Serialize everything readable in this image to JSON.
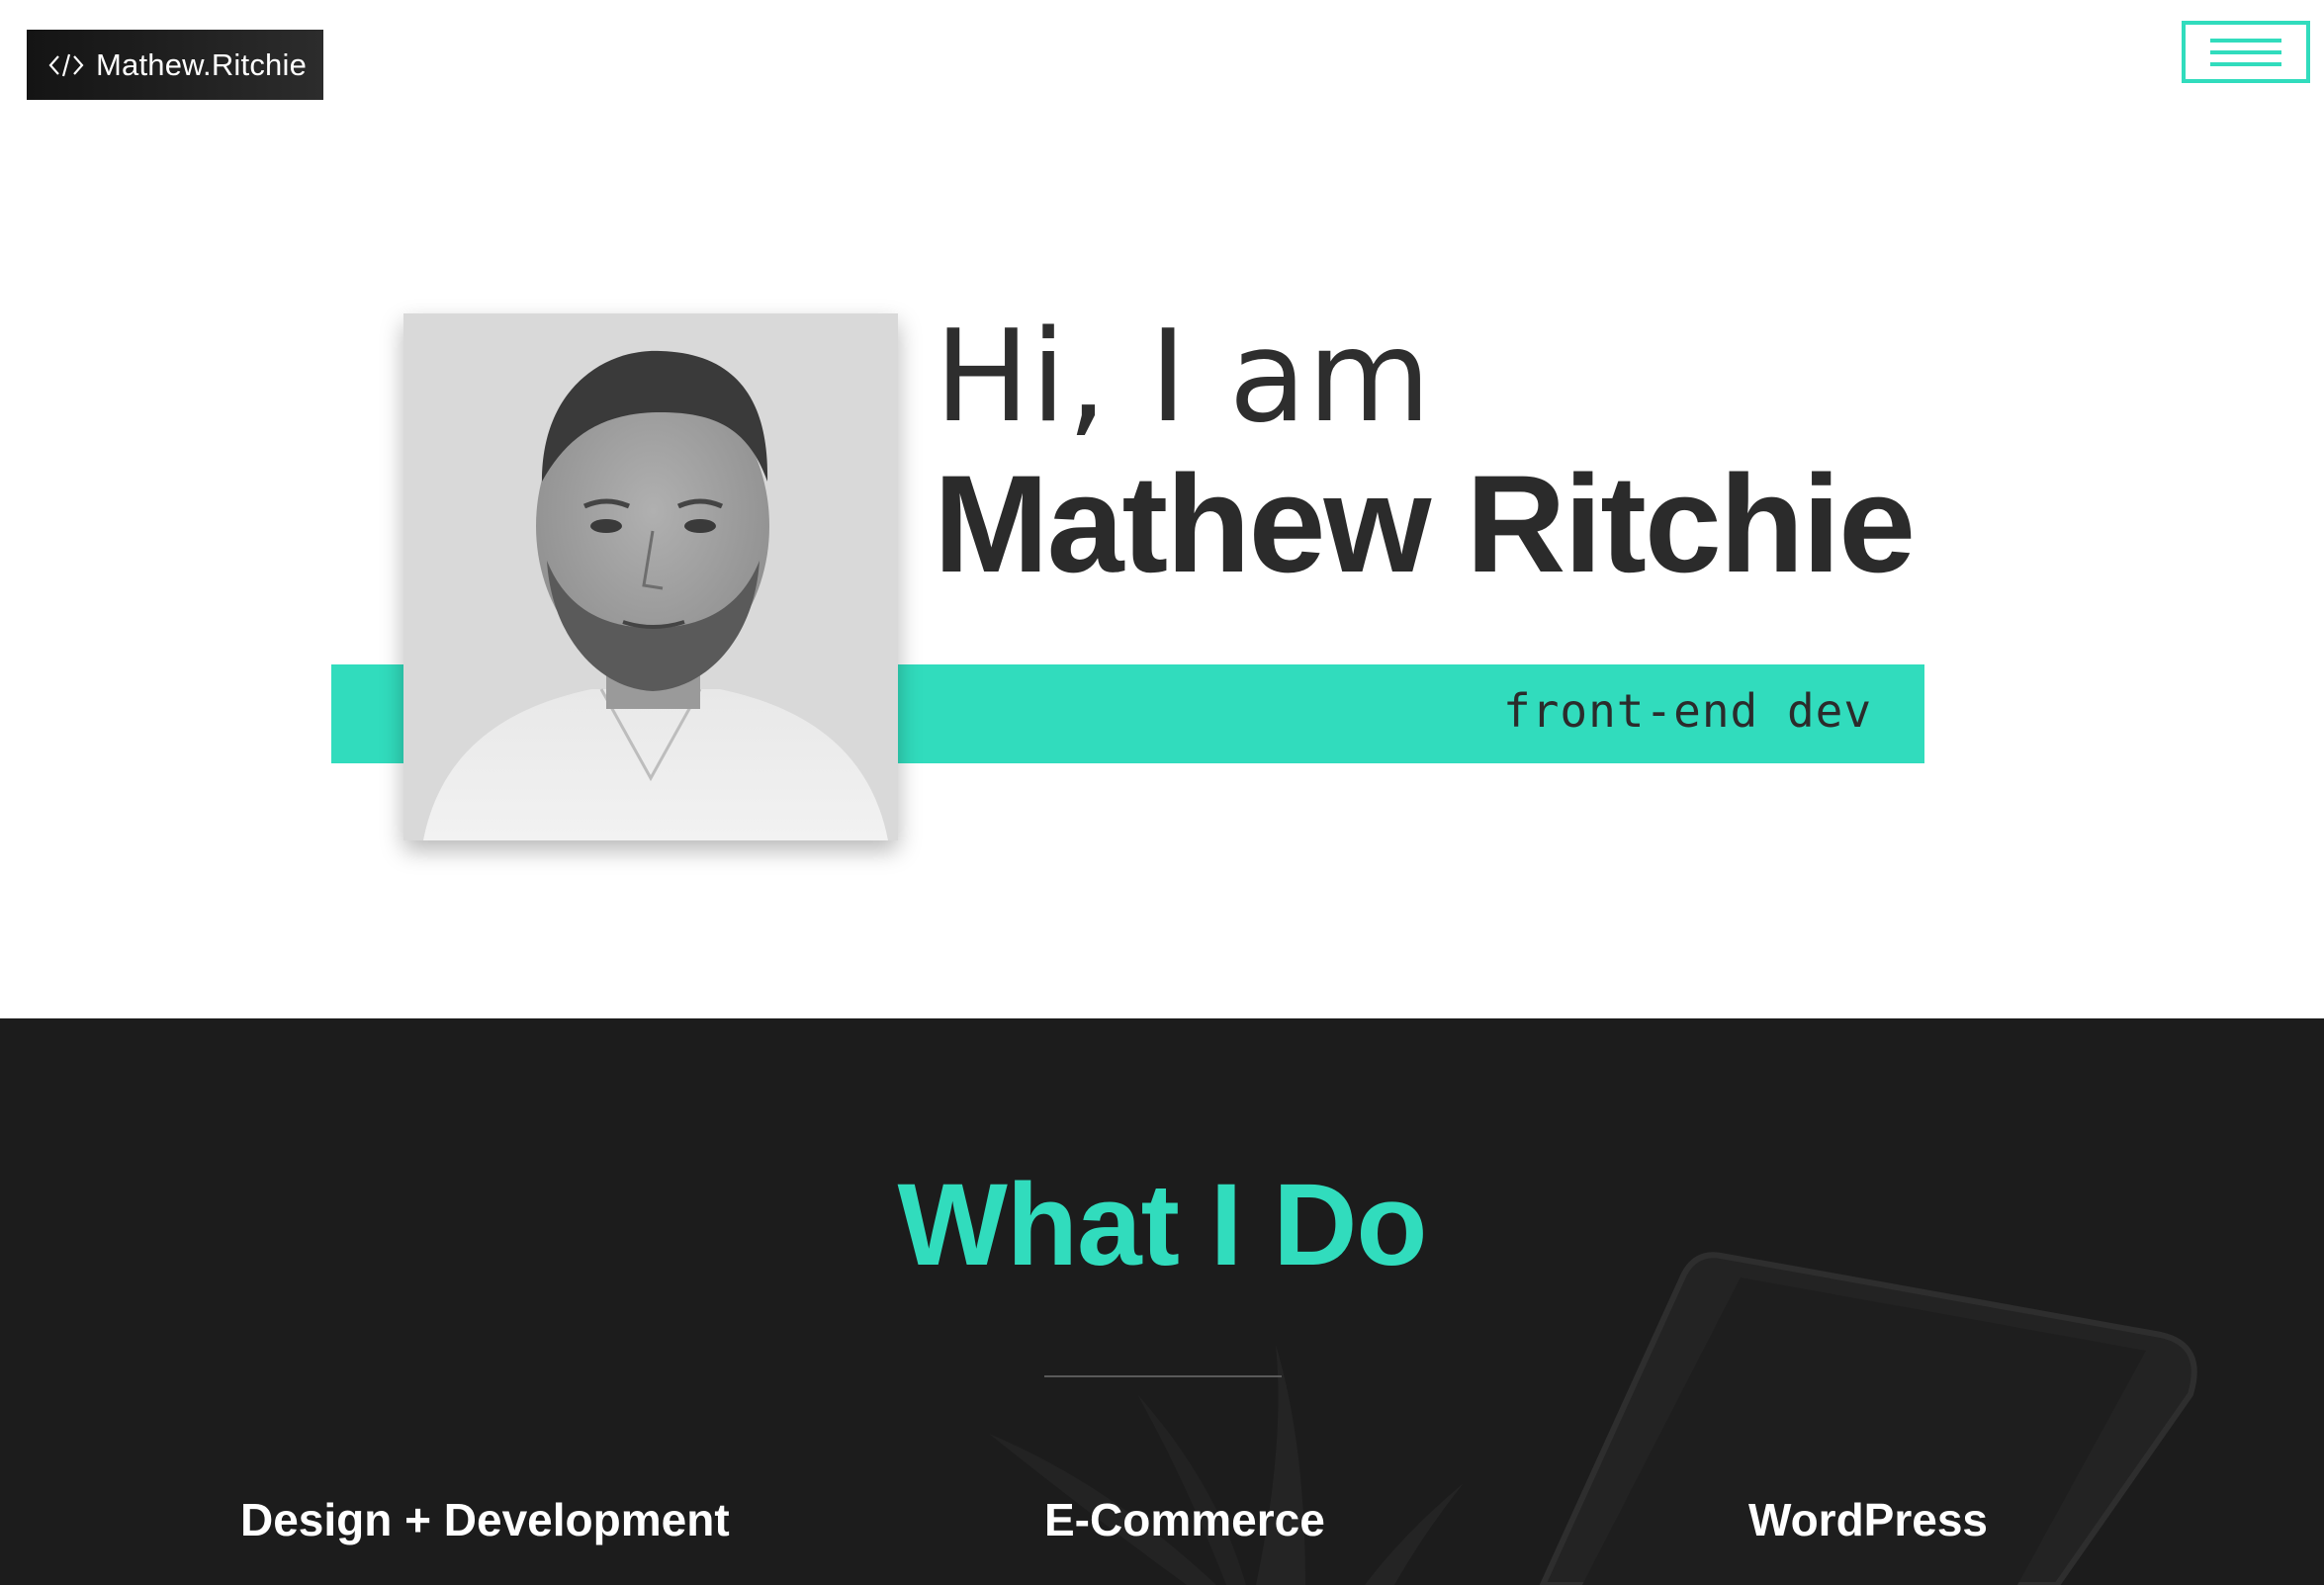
{
  "header": {
    "logo_icon": "code-brackets-icon",
    "logo_text": "Mathew.Ritchie",
    "menu_icon": "hamburger-icon"
  },
  "hero": {
    "greeting": "Hi, I am",
    "name": "Mathew Ritchie",
    "role": "front-end dev",
    "portrait": "portrait-photo"
  },
  "services": {
    "title": "What I Do",
    "items": [
      {
        "label": "Design + Development"
      },
      {
        "label": "E-Commerce"
      },
      {
        "label": "WordPress"
      }
    ]
  },
  "colors": {
    "accent": "#31dcbd",
    "dark": "#1c1c1c",
    "text": "#2b2b2b"
  }
}
